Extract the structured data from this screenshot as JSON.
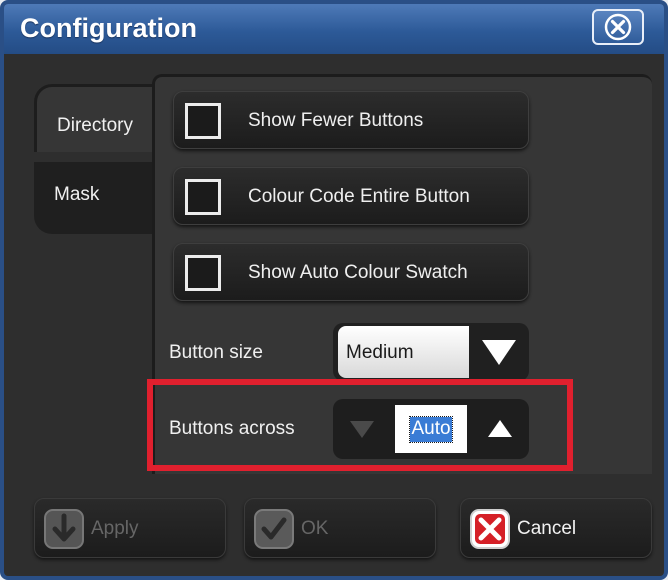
{
  "window": {
    "title": "Configuration"
  },
  "tabs": [
    {
      "label": "Directory",
      "active": true
    },
    {
      "label": "Mask",
      "active": false
    }
  ],
  "options": [
    {
      "label": "Show Fewer Buttons",
      "checked": false
    },
    {
      "label": "Colour Code Entire Button",
      "checked": false
    },
    {
      "label": "Show Auto Colour Swatch",
      "checked": false
    }
  ],
  "button_size": {
    "label": "Button size",
    "value": "Medium"
  },
  "buttons_across": {
    "label": "Buttons across",
    "value": "Auto"
  },
  "actions": {
    "apply": {
      "label": "Apply",
      "enabled": false
    },
    "ok": {
      "label": "OK",
      "enabled": false
    },
    "cancel": {
      "label": "Cancel",
      "enabled": true
    }
  },
  "colors": {
    "titlebar": "#2d5a98",
    "highlight": "#e0202e",
    "selection": "#3a7cd5",
    "cancel_icon": "#d52027"
  }
}
